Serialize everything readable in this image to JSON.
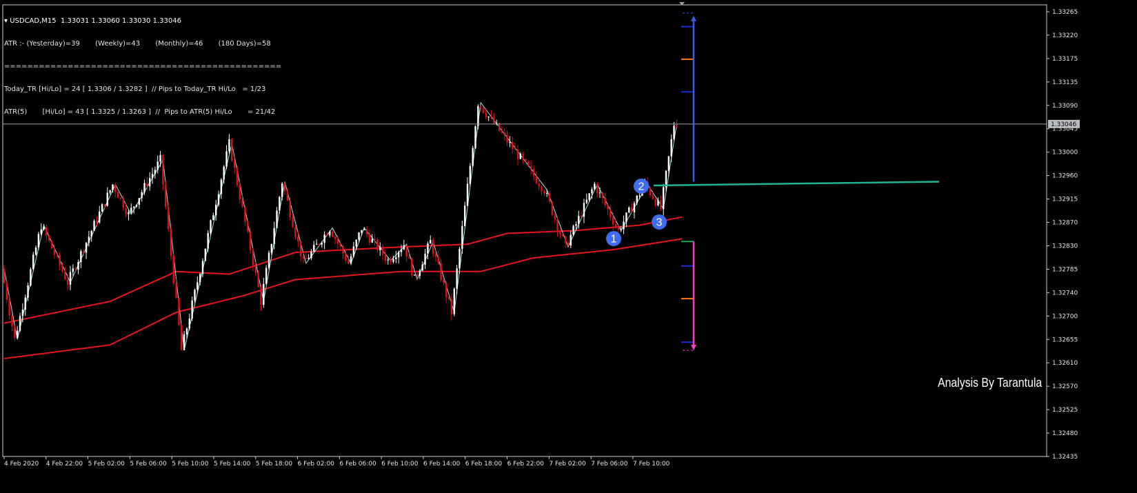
{
  "info": {
    "symbol_line": "USDCAD,M15  1.33031 1.33060 1.33030 1.33046",
    "atr_line": "ATR :- (Yesterday)=39       (Weekly)=43       (Monthly)=46       (180 Days)=58",
    "separator": "================================================",
    "today_tr_line": "Today_TR [Hi/Lo] = 24 [ 1.3306 / 1.3282 ]  // Pips to Today_TR Hi/Lo   = 1/23",
    "atr5_line": "ATR(5)       [Hi/Lo] = 43 [ 1.3325 / 1.3263 ]  //  Pips to ATR(5) Hi/Lo       = 21/42"
  },
  "signature": "Analysis By Tarantula",
  "current_price_label": "1.33046",
  "colors": {
    "background": "#000000",
    "bull": "#ffffff",
    "bear": "#e0101a",
    "ma": "#e8141e",
    "zigzag": "#9fe8e0",
    "price_line": "#9aa0a6",
    "level_line": "#20b393",
    "up_arrow": "#3a5fe0",
    "down_arrow": "#ff3ac8",
    "badge": "#3f6cf0",
    "level_orange": "#ff7a1a",
    "level_blue": "#1d2fd8",
    "level_green": "#22a84a"
  },
  "badges": [
    "1",
    "2",
    "3"
  ],
  "chart_data": {
    "type": "candlestick",
    "symbol": "USDCAD",
    "timeframe": "M15",
    "ylim": [
      1.32435,
      1.33265
    ],
    "y_ticks": [
      "1.33265",
      "1.33220",
      "1.33175",
      "1.33135",
      "1.33090",
      "1.33045",
      "1.33000",
      "1.32960",
      "1.32915",
      "1.32870",
      "1.32830",
      "1.32785",
      "1.32740",
      "1.32700",
      "1.32655",
      "1.32610",
      "1.32570",
      "1.32525",
      "1.32480",
      "1.32435"
    ],
    "x_ticks": [
      "4 Feb 2020",
      "4 Feb 22:00",
      "5 Feb 02:00",
      "5 Feb 06:00",
      "5 Feb 10:00",
      "5 Feb 14:00",
      "5 Feb 18:00",
      "6 Feb 02:00",
      "6 Feb 06:00",
      "6 Feb 10:00",
      "6 Feb 14:00",
      "6 Feb 18:00",
      "6 Feb 22:00",
      "7 Feb 02:00",
      "7 Feb 06:00",
      "7 Feb 10:00"
    ],
    "current_price": 1.33046,
    "zigzag_anchors": [
      [
        0,
        1.3278
      ],
      [
        5,
        1.3265
      ],
      [
        15,
        1.3286
      ],
      [
        25,
        1.32755
      ],
      [
        42,
        1.32935
      ],
      [
        48,
        1.3288
      ],
      [
        60,
        1.3298
      ],
      [
        68,
        1.3263
      ],
      [
        86,
        1.3301
      ],
      [
        98,
        1.3272
      ],
      [
        106,
        1.3294
      ],
      [
        114,
        1.3279
      ],
      [
        124,
        1.32855
      ],
      [
        131,
        1.3279
      ],
      [
        136,
        1.32855
      ],
      [
        146,
        1.32795
      ],
      [
        152,
        1.32825
      ],
      [
        156,
        1.3276
      ],
      [
        162,
        1.3283
      ],
      [
        170,
        1.327
      ],
      [
        180,
        1.33085
      ],
      [
        205,
        1.32925
      ],
      [
        213,
        1.3282
      ],
      [
        224,
        1.32935
      ],
      [
        233,
        1.3285
      ],
      [
        243,
        1.32935
      ],
      [
        249,
        1.3289
      ],
      [
        254,
        1.33046
      ]
    ],
    "ma_fast_anchors": [
      [
        0,
        1.3268
      ],
      [
        40,
        1.3272
      ],
      [
        65,
        1.32775
      ],
      [
        85,
        1.3277
      ],
      [
        110,
        1.3281
      ],
      [
        150,
        1.3282
      ],
      [
        175,
        1.32825
      ],
      [
        190,
        1.32845
      ],
      [
        215,
        1.3285
      ],
      [
        240,
        1.3286
      ],
      [
        256,
        1.32875
      ]
    ],
    "ma_slow_anchors": [
      [
        0,
        1.32615
      ],
      [
        40,
        1.3264
      ],
      [
        65,
        1.327
      ],
      [
        90,
        1.3273
      ],
      [
        110,
        1.3276
      ],
      [
        150,
        1.32775
      ],
      [
        180,
        1.32775
      ],
      [
        200,
        1.328
      ],
      [
        230,
        1.32815
      ],
      [
        256,
        1.32835
      ]
    ],
    "atr_levels": {
      "upper": [
        1.33225,
        1.33165,
        1.33105
      ],
      "zone_top": 1.3294,
      "zone_line": 1.3294,
      "lower_green": 1.3283,
      "lower": [
        1.32785,
        1.32725,
        1.32645
      ]
    }
  }
}
